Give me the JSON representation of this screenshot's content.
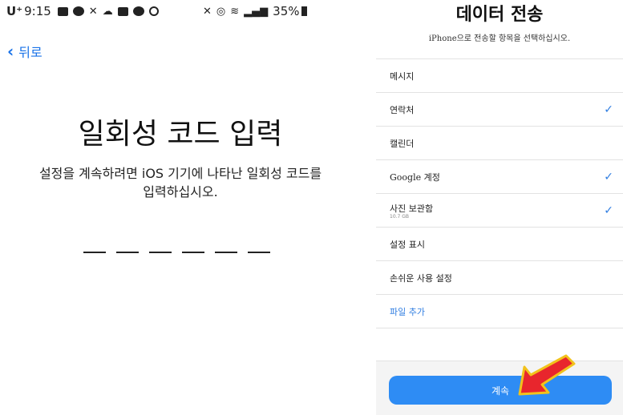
{
  "left": {
    "status": {
      "carrier": "U⁺",
      "time": "9:15",
      "battery": "35%",
      "icons": [
        "message-icon",
        "talk-icon",
        "missed-call-icon",
        "weather-icon",
        "box-icon",
        "chat-icon",
        "circle-icon",
        "mute-icon",
        "nfc-icon",
        "wifi-icon",
        "signal-icon",
        "battery-icon"
      ]
    },
    "back_label": "뒤로",
    "title": "일회성 코드 입력",
    "description_line1": "설정을 계속하려면 iOS 기기에 나타난 일회성 코드를",
    "description_line2": "입력하십시오.",
    "code_slots": 6
  },
  "right": {
    "title": "데이터 전송",
    "subtitle": "iPhone으로 전송할 항목을 선택하십시오.",
    "items": [
      {
        "label": "메시지",
        "checked": false
      },
      {
        "label": "연락처",
        "checked": true
      },
      {
        "label": "캘린더",
        "checked": false
      },
      {
        "label": "Google 계정",
        "checked": true
      },
      {
        "label": "사진 보관함",
        "sub": "10.7 GB",
        "checked": true
      },
      {
        "label": "설정 표시",
        "checked": false
      },
      {
        "label": "손쉬운 사용 설정",
        "checked": false
      },
      {
        "label": "파일 추가",
        "checked": false,
        "link": true
      }
    ],
    "check_glyph": "✓",
    "continue_label": "계속",
    "colors": {
      "accent": "#2e8cf4",
      "arrow": "#e8262d",
      "arrow_outline": "#f2c21b"
    }
  }
}
